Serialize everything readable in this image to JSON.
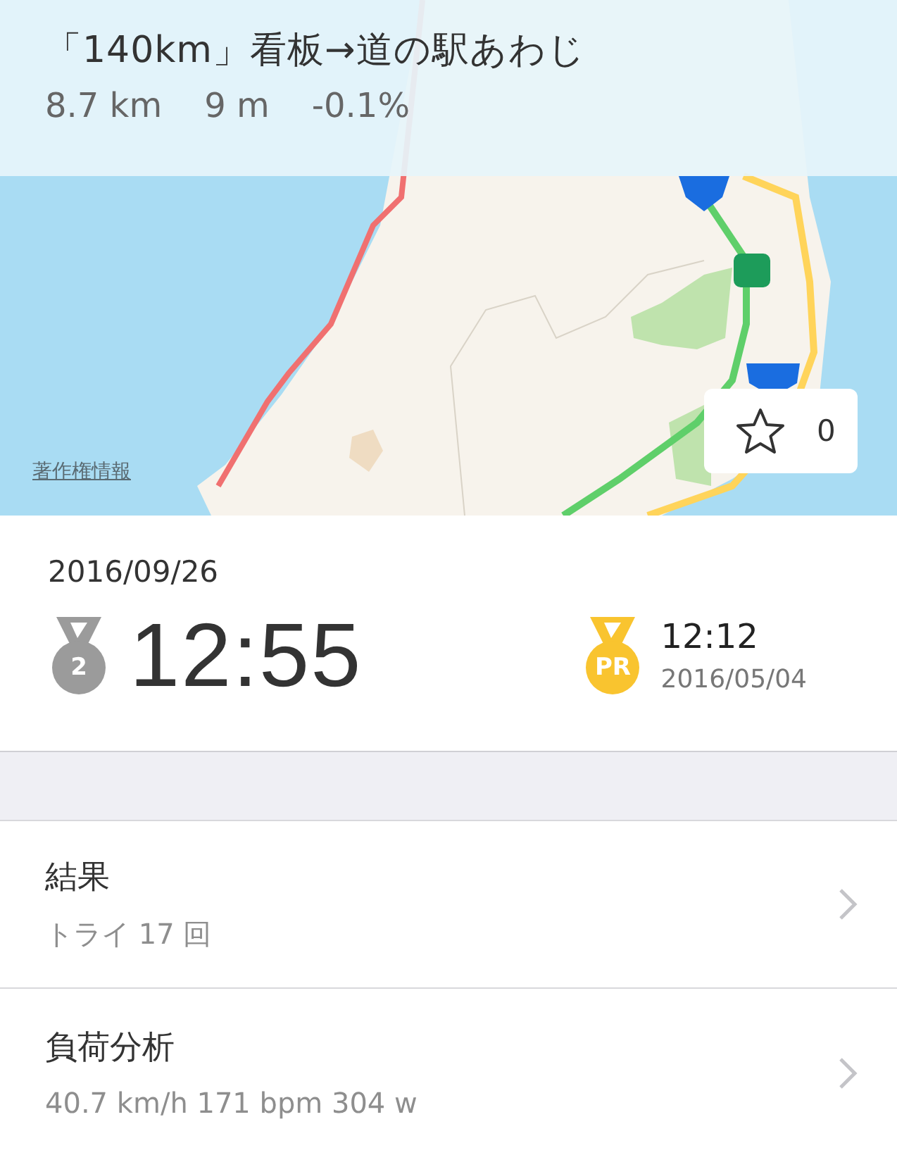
{
  "segment": {
    "title": "「140km」看板→道の駅あわじ",
    "distance": "8.7 km",
    "elevation": "9 m",
    "grade": "-0.1%"
  },
  "map": {
    "kind": "picture",
    "copyright_link": "著作権情報",
    "star": {
      "starred": false,
      "count": "0"
    }
  },
  "effort": {
    "date": "2016/09/26",
    "rank": "2",
    "time": "12:55",
    "pr": {
      "label": "PR",
      "time": "12:12",
      "date": "2016/05/04"
    }
  },
  "rows": [
    {
      "title": "結果",
      "subtitle": "トライ 17 回"
    },
    {
      "title": "負荷分析",
      "subtitle": "40.7 km/h 171 bpm 304 w"
    }
  ]
}
